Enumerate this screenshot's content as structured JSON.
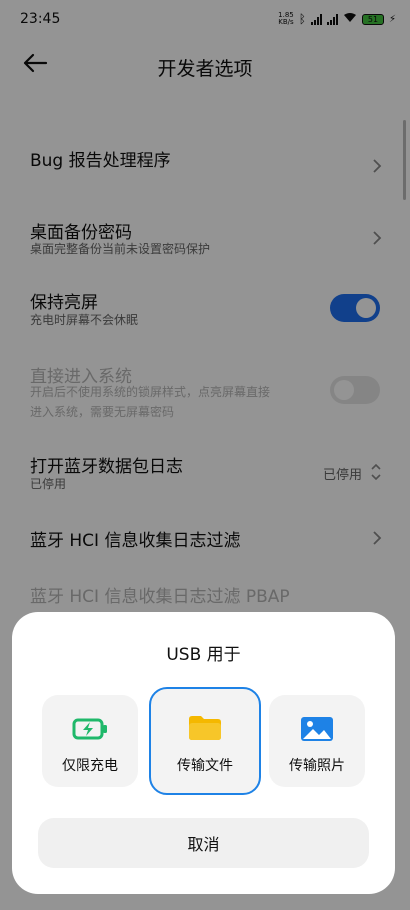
{
  "status_bar": {
    "time": "23:45",
    "speed": "1.85\nKB/s",
    "battery": "51"
  },
  "header": {
    "title": "开发者选项"
  },
  "settings": {
    "bug_report": {
      "title": "Bug 报告处理程序"
    },
    "backup_password": {
      "title": "桌面备份密码",
      "subtitle": "桌面完整备份当前未设置密码保护"
    },
    "stay_awake": {
      "title": "保持亮屏",
      "subtitle": "充电时屏幕不会休眠",
      "enabled": true
    },
    "direct_boot": {
      "title": "直接进入系统",
      "subtitle_line1": "开启后不使用系统的锁屏样式，点亮屏幕直接",
      "subtitle_line2": "进入系统，需要无屏幕密码",
      "enabled": false
    },
    "bt_snoop": {
      "title": "打开蓝牙数据包日志",
      "subtitle": "已停用",
      "value": "已停用"
    },
    "bt_hci_filter": {
      "title": "蓝牙 HCI 信息收集日志过滤"
    },
    "bt_hci_pbap": {
      "title": "蓝牙 HCI 信息收集日志过滤 PBAP"
    }
  },
  "usb_dialog": {
    "title": "USB 用于",
    "options": [
      {
        "label": "仅限充电",
        "icon": "battery-charging-icon",
        "selected": false
      },
      {
        "label": "传输文件",
        "icon": "folder-icon",
        "selected": true
      },
      {
        "label": "传输照片",
        "icon": "photo-icon",
        "selected": false
      }
    ],
    "cancel_label": "取消"
  },
  "colors": {
    "accent": "#1e6ff0",
    "selected_border": "#1e82e6",
    "charge_green": "#1fb86a",
    "folder_yellow": "#f5b800",
    "photo_blue": "#1e82e6"
  }
}
